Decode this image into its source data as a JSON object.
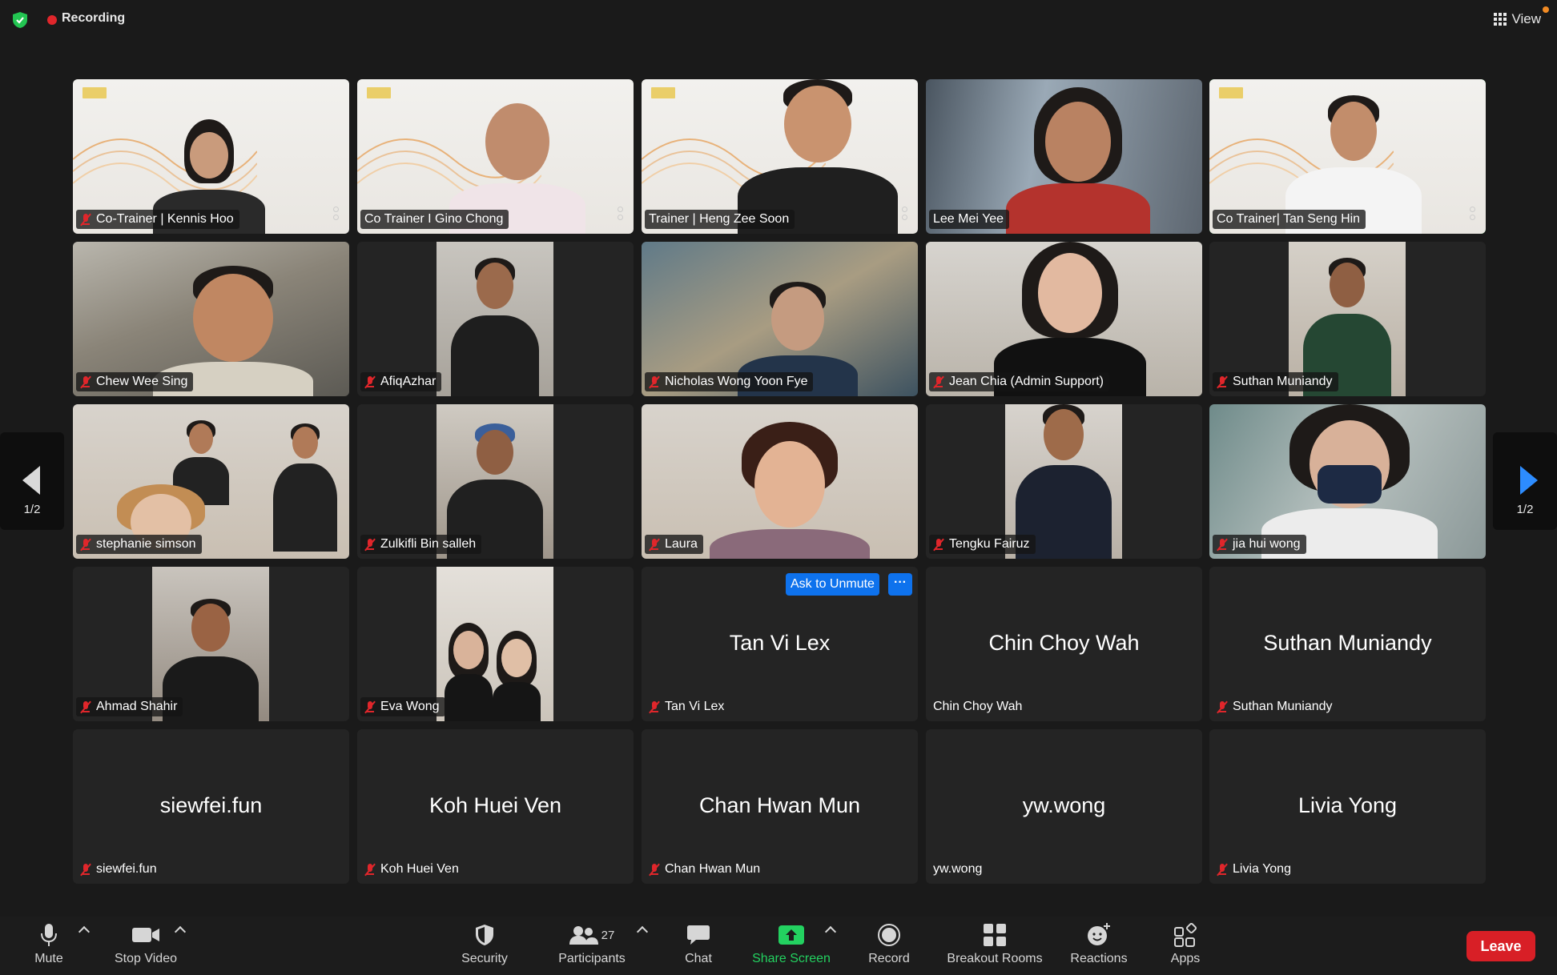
{
  "top_bar": {
    "recording_label": "Recording",
    "view_label": "View",
    "security_color": "#23c552",
    "recording_color": "#e0262b"
  },
  "pagination": {
    "left_page": "1/2",
    "right_page": "1/2"
  },
  "participants": [
    {
      "name": "Co-Trainer | Kennis Hoo",
      "muted": true,
      "video": true
    },
    {
      "name": "Co Trainer I Gino Chong",
      "muted": false,
      "video": true
    },
    {
      "name": "Trainer | Heng Zee Soon",
      "muted": false,
      "video": true
    },
    {
      "name": "Lee Mei Yee",
      "muted": false,
      "video": true
    },
    {
      "name": "Co Trainer| Tan Seng Hin",
      "muted": false,
      "video": true,
      "active_speaker": true
    },
    {
      "name": "Chew Wee Sing",
      "muted": true,
      "video": true
    },
    {
      "name": "AfiqAzhar",
      "muted": true,
      "video": true
    },
    {
      "name": "Nicholas Wong Yoon Fye",
      "muted": true,
      "video": true
    },
    {
      "name": "Jean Chia (Admin Support)",
      "muted": true,
      "video": true
    },
    {
      "name": "Suthan Muniandy",
      "muted": true,
      "video": true
    },
    {
      "name": "stephanie simson",
      "muted": true,
      "video": true
    },
    {
      "name": "Zulkifli Bin salleh",
      "muted": true,
      "video": true
    },
    {
      "name": "Laura",
      "muted": true,
      "video": true
    },
    {
      "name": "Tengku Fairuz",
      "muted": true,
      "video": true
    },
    {
      "name": "jia hui wong",
      "muted": true,
      "video": true
    },
    {
      "name": "Ahmad Shahir",
      "muted": true,
      "video": true
    },
    {
      "name": "Eva Wong",
      "muted": true,
      "video": true
    },
    {
      "name": "Tan Vi Lex",
      "muted": true,
      "video": false,
      "display_name": "Tan Vi Lex"
    },
    {
      "name": "Chin Choy Wah",
      "muted": false,
      "video": false,
      "display_name": "Chin Choy Wah"
    },
    {
      "name": "Suthan Muniandy",
      "muted": true,
      "video": false,
      "display_name": "Suthan Muniandy"
    },
    {
      "name": "siewfei.fun",
      "muted": true,
      "video": false,
      "display_name": "siewfei.fun"
    },
    {
      "name": "Koh Huei Ven",
      "muted": true,
      "video": false,
      "display_name": "Koh Huei Ven"
    },
    {
      "name": "Chan Hwan Mun",
      "muted": true,
      "video": false,
      "display_name": "Chan Hwan Mun"
    },
    {
      "name": "yw.wong",
      "muted": false,
      "video": false,
      "display_name": "yw.wong"
    },
    {
      "name": "Livia Yong",
      "muted": true,
      "video": false,
      "display_name": "Livia Yong"
    }
  ],
  "hover_actions": {
    "ask_to_unmute": "Ask to Unmute",
    "more": "···"
  },
  "toolbar": {
    "mute": "Mute",
    "stop_video": "Stop Video",
    "security": "Security",
    "participants": "Participants",
    "participant_count": "27",
    "chat": "Chat",
    "share_screen": "Share Screen",
    "record": "Record",
    "breakout_rooms": "Breakout Rooms",
    "reactions": "Reactions",
    "apps": "Apps",
    "leave": "Leave",
    "share_color": "#23d160",
    "leave_color": "#d81f26"
  }
}
